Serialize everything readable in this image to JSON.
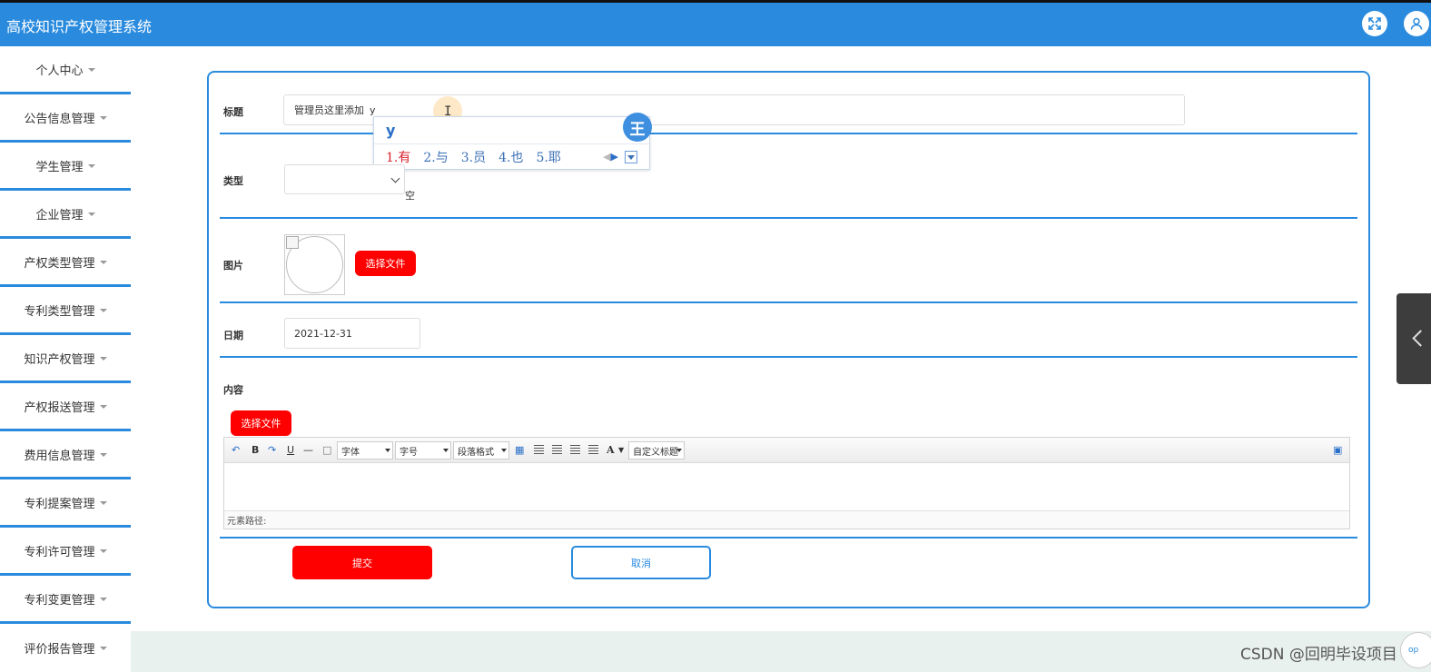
{
  "app": {
    "title": "高校知识产权管理系统"
  },
  "header": {
    "fullscreen_icon": "expand-icon",
    "user_icon": "user-icon"
  },
  "sidebar": {
    "items": [
      {
        "label": "个人中心"
      },
      {
        "label": "公告信息管理"
      },
      {
        "label": "学生管理"
      },
      {
        "label": "企业管理"
      },
      {
        "label": "产权类型管理"
      },
      {
        "label": "专利类型管理"
      },
      {
        "label": "知识产权管理"
      },
      {
        "label": "产权报送管理"
      },
      {
        "label": "费用信息管理"
      },
      {
        "label": "专利提案管理"
      },
      {
        "label": "专利许可管理"
      },
      {
        "label": "专利变更管理"
      },
      {
        "label": "评价报告管理"
      }
    ]
  },
  "form": {
    "title_label": "标题",
    "title_value": "管理员这里添加",
    "title_typing": "y",
    "type_label": "类型",
    "type_value": "",
    "type_hint": "空",
    "image_label": "图片",
    "image_button": "选择文件",
    "date_label": "日期",
    "date_value": "2021-12-31",
    "content_label": "内容",
    "content_button": "选择文件",
    "submit_label": "提交",
    "cancel_label": "取消"
  },
  "ime": {
    "composition": "y",
    "candidates": [
      "1.有",
      "2.与",
      "3.员",
      "4.也",
      "5.耶"
    ],
    "logo_text": "王"
  },
  "editor": {
    "bold": "B",
    "underline": "U",
    "font_family": "字体",
    "font_size": "字号",
    "paragraph": "段落格式",
    "font_color": "A",
    "custom_heading": "自定义标题",
    "element_path": "元素路径:"
  },
  "watermark": "CSDN @回明毕设项目",
  "corner_label": "op"
}
